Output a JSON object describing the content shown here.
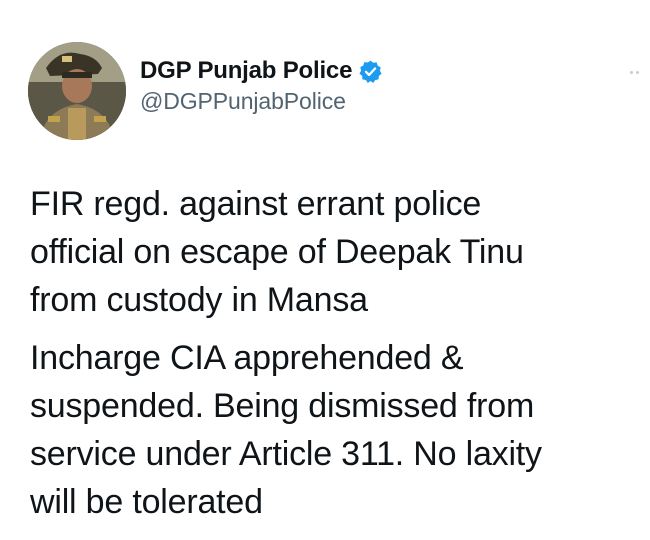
{
  "tweet": {
    "author": {
      "display_name": "DGP Punjab Police",
      "handle": "@DGPPunjabPolice",
      "verified": true,
      "verified_color": "#1d9bf0"
    },
    "more_icon": "more-horizontal-icon",
    "paragraphs": [
      "FIR regd. against errant police\nofficial on escape of Deepak Tinu\nfrom custody in Mansa",
      "Incharge CIA apprehended &\nsuspended. Being dismissed from\nservice under Article 311. No laxity\nwill be tolerated"
    ]
  },
  "colors": {
    "text": "#0f1419",
    "secondary_text": "#536471",
    "background": "#ffffff"
  }
}
